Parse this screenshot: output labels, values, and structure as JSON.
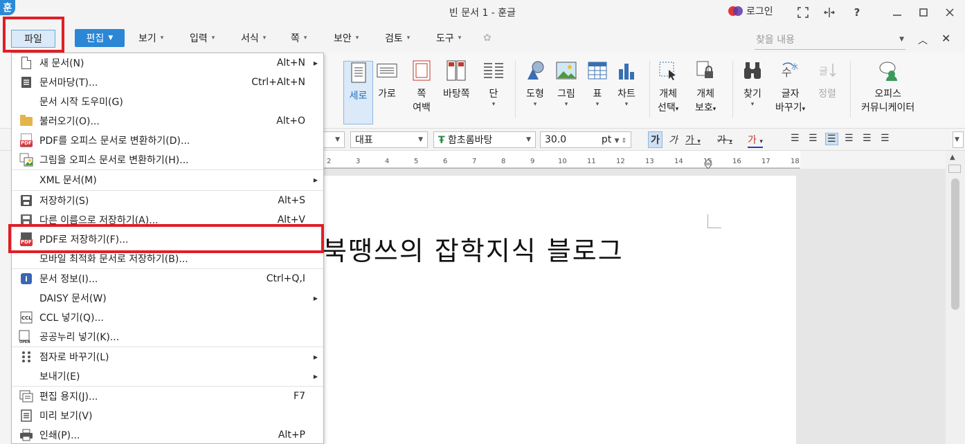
{
  "titlebar": {
    "logo": "훈",
    "title": "빈 문서 1 - 훈글",
    "login_label": "로그인",
    "icons": [
      "fullscreen-icon",
      "split-view-icon",
      "help-icon",
      "minimize-icon",
      "maximize-icon",
      "close-icon"
    ]
  },
  "menubar": {
    "items": [
      {
        "label": "파일"
      },
      {
        "label": "편집"
      },
      {
        "label": "보기"
      },
      {
        "label": "입력"
      },
      {
        "label": "서식"
      },
      {
        "label": "쪽"
      },
      {
        "label": "보안"
      },
      {
        "label": "검토"
      },
      {
        "label": "도구"
      }
    ],
    "search_placeholder": "찾을 내용"
  },
  "ribbon": {
    "buttons": [
      {
        "label": "세로"
      },
      {
        "label": "가로"
      },
      {
        "label": "쪽",
        "label2": "여백"
      },
      {
        "label": "바탕쪽"
      },
      {
        "label": "단"
      },
      {
        "label": "도형"
      },
      {
        "label": "그림"
      },
      {
        "label": "표"
      },
      {
        "label": "차트"
      },
      {
        "label": "개체",
        "label2": "선택"
      },
      {
        "label": "개체",
        "label2": "보호"
      },
      {
        "label": "찾기"
      },
      {
        "label": "글자",
        "label2": "바꾸기"
      },
      {
        "label": "정렬"
      },
      {
        "label": "오피스",
        "label2": "커뮤니케이터"
      }
    ]
  },
  "formatbar": {
    "style": "대표",
    "font": "함초롬바탕",
    "size": "30.0",
    "unit": "pt"
  },
  "ruler": {
    "ticks": [
      "2",
      "3",
      "4",
      "5",
      "6",
      "7",
      "8",
      "9",
      "10",
      "11",
      "12",
      "13",
      "14",
      "15",
      "16",
      "17",
      "18"
    ]
  },
  "document": {
    "text": "북땡쓰의 잡학지식 블로그"
  },
  "file_menu": {
    "items": [
      {
        "label": "새 문서(N)",
        "shortcut": "Alt+N",
        "submenu": true,
        "icon": "new-document-icon"
      },
      {
        "label": "문서마당(T)...",
        "shortcut": "Ctrl+Alt+N",
        "submenu": false,
        "icon": "template-icon"
      },
      {
        "label": "문서 시작 도우미(G)",
        "shortcut": "",
        "submenu": false,
        "icon": ""
      },
      {
        "label": "불러오기(O)...",
        "shortcut": "Alt+O",
        "submenu": false,
        "icon": "open-folder-icon"
      },
      {
        "label": "PDF를 오피스 문서로 변환하기(D)...",
        "shortcut": "",
        "submenu": false,
        "icon": "pdf-icon"
      },
      {
        "label": "그림을 오피스 문서로 변환하기(H)...",
        "shortcut": "",
        "submenu": false,
        "icon": "image-convert-icon"
      },
      {
        "label": "XML 문서(M)",
        "shortcut": "",
        "submenu": true,
        "icon": ""
      },
      {
        "label": "저장하기(S)",
        "shortcut": "Alt+S",
        "submenu": false,
        "icon": "save-icon"
      },
      {
        "label": "다른 이름으로 저장하기(A)...",
        "shortcut": "Alt+V",
        "submenu": false,
        "icon": "save-as-icon"
      },
      {
        "label": "PDF로 저장하기(F)...",
        "shortcut": "",
        "submenu": false,
        "icon": "save-pdf-icon"
      },
      {
        "label": "모바일 최적화 문서로 저장하기(B)...",
        "shortcut": "",
        "submenu": false,
        "icon": ""
      },
      {
        "label": "문서 정보(I)...",
        "shortcut": "Ctrl+Q,I",
        "submenu": false,
        "icon": "info-icon"
      },
      {
        "label": "DAISY 문서(W)",
        "shortcut": "",
        "submenu": true,
        "icon": ""
      },
      {
        "label": "CCL 넣기(Q)...",
        "shortcut": "",
        "submenu": false,
        "icon": "ccl-icon"
      },
      {
        "label": "공공누리 넣기(K)...",
        "shortcut": "",
        "submenu": false,
        "icon": "open-license-icon"
      },
      {
        "label": "점자로 바꾸기(L)",
        "shortcut": "",
        "submenu": true,
        "icon": "braille-icon"
      },
      {
        "label": "보내기(E)",
        "shortcut": "",
        "submenu": true,
        "icon": ""
      },
      {
        "label": "편집 용지(J)...",
        "shortcut": "F7",
        "submenu": false,
        "icon": "page-setup-icon"
      },
      {
        "label": "미리 보기(V)",
        "shortcut": "",
        "submenu": false,
        "icon": "preview-icon"
      },
      {
        "label": "인쇄(P)...",
        "shortcut": "Alt+P",
        "submenu": false,
        "icon": "print-icon"
      }
    ]
  },
  "colors": {
    "accent": "#2b86d6",
    "highlight_red": "#e01e26"
  }
}
